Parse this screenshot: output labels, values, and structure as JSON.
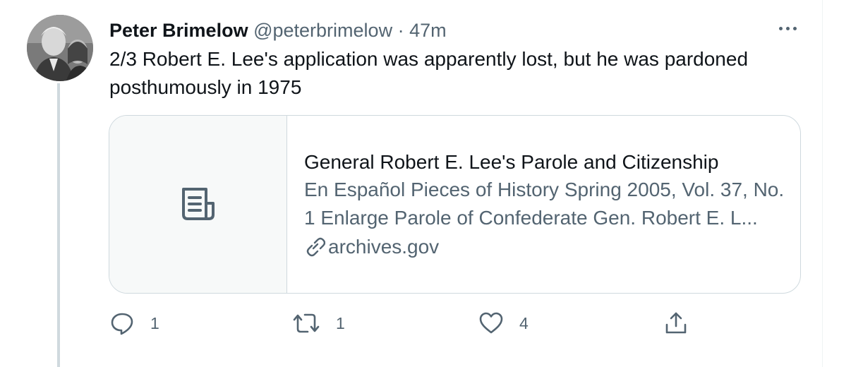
{
  "tweet": {
    "author_name": "Peter Brimelow",
    "handle": "@peterbrimelow",
    "separator": "·",
    "time": "47m",
    "text": "2/3 Robert E. Lee's application was apparently lost, but he was pardoned posthumously in 1975"
  },
  "card": {
    "title": "General Robert E. Lee's Parole and Citizenship",
    "description": "En Español Pieces of History Spring 2005, Vol. 37, No. 1   Enlarge   Parole of Confederate Gen. Robert E. L...",
    "domain": "archives.gov",
    "thumbnail_icon": "document-icon",
    "domain_icon": "link-icon"
  },
  "actions": {
    "reply_count": "1",
    "retweet_count": "1",
    "like_count": "4",
    "icons": [
      "reply-icon",
      "retweet-icon",
      "like-icon",
      "share-icon"
    ]
  },
  "colors": {
    "text_primary": "#0f1419",
    "text_secondary": "#536471",
    "border": "#cfd9de",
    "card_thumb_bg": "#f7f9f9"
  }
}
